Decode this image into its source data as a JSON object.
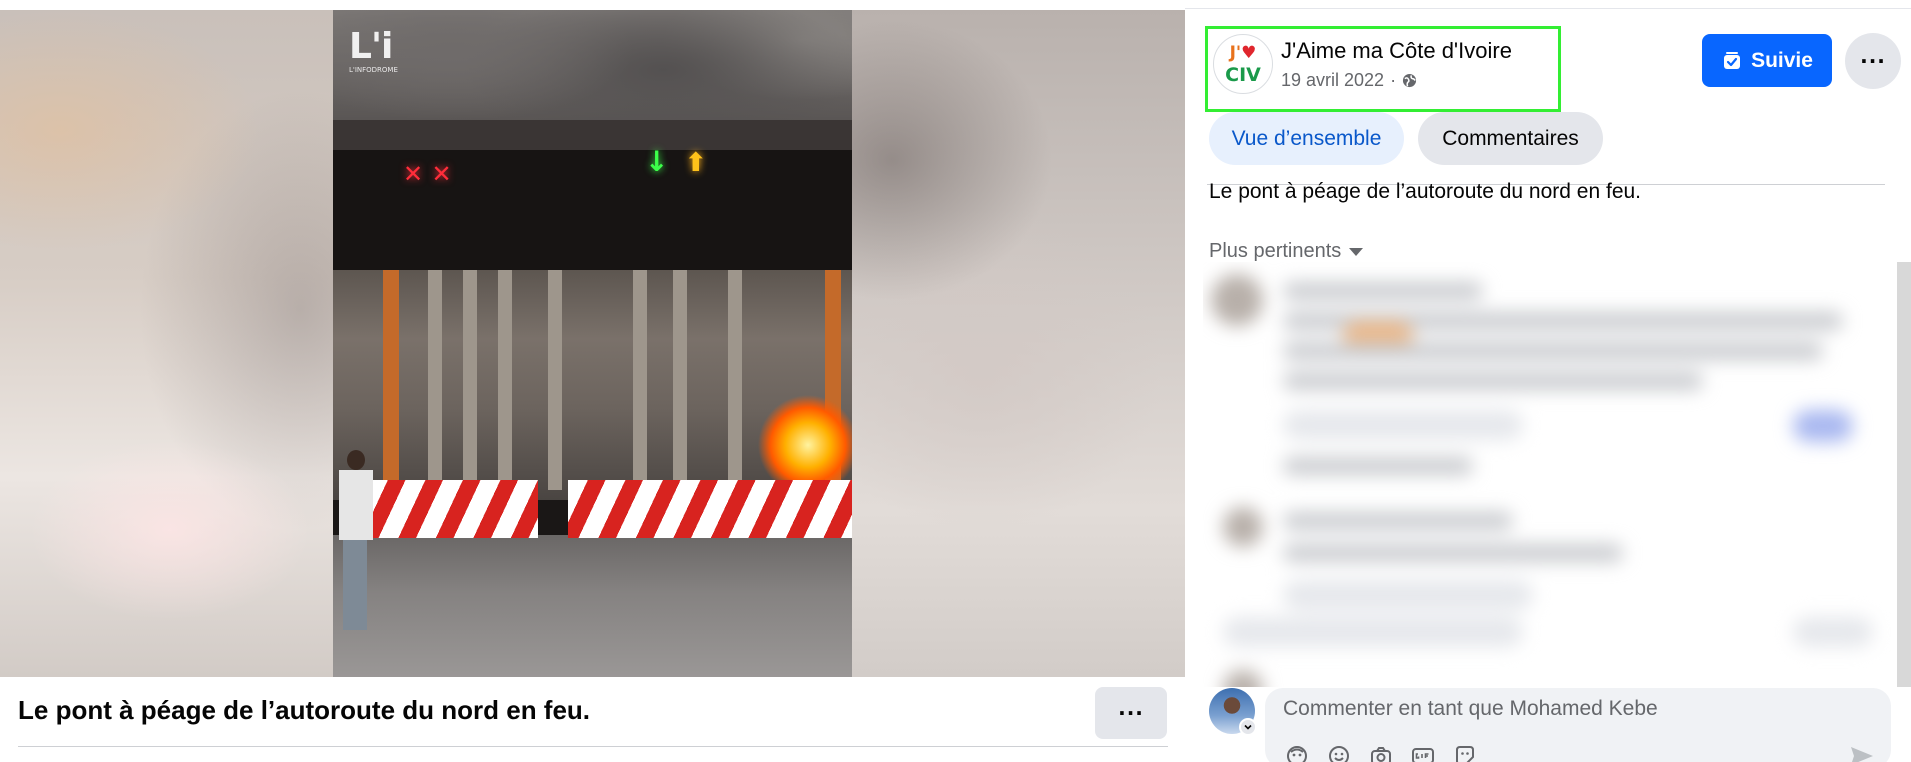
{
  "video": {
    "overlay_logo": "L'i",
    "overlay_logo_sub": "L'INFODROME",
    "sign_red": "✕ ✕",
    "sign_green": "↓",
    "sign_amber": "⬆"
  },
  "post_caption": {
    "title": "Le pont à péage de l’autoroute du nord en feu.",
    "more_label": "···"
  },
  "author": {
    "avatar_text_top": "J'",
    "avatar_heart": "♥",
    "avatar_text_bottom": "CIV",
    "name": "J'Aime ma Côte d'Ivoire",
    "date": "19 avril 2022",
    "separator": "·",
    "audience_icon": "globe-icon"
  },
  "actions": {
    "follow_label": "Suivie",
    "follow_icon": "followed-check-icon",
    "more_label": "···"
  },
  "tabs": [
    {
      "label": "Vue d’ensemble",
      "active": true
    },
    {
      "label": "Commentaires",
      "active": false
    }
  ],
  "post_text": "Le pont à péage de l’autoroute du nord en feu.",
  "comments": {
    "sort_label": "Plus pertinents",
    "sort_icon": "caret-down-icon"
  },
  "composer": {
    "placeholder": "Commenter en tant que Mohamed Kebe",
    "icons": [
      "avatar-sticker-icon",
      "emoji-icon",
      "camera-icon",
      "gif-icon",
      "sticker-icon"
    ],
    "send_icon": "send-icon"
  },
  "colors": {
    "brand_blue": "#0866ff",
    "tab_active_bg": "#e7f0fd",
    "tab_active_text": "#0a58ca",
    "highlight_box": "#33ee33"
  }
}
